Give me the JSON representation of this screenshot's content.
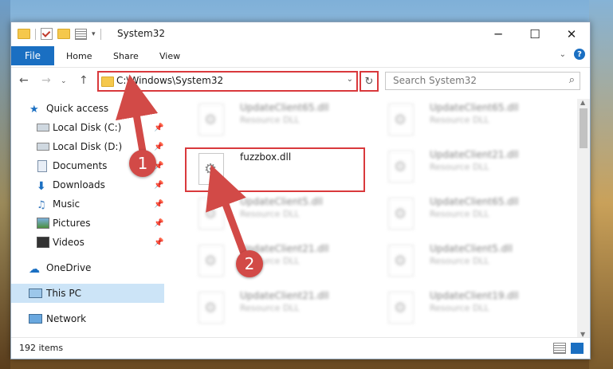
{
  "window": {
    "title": "System32"
  },
  "ribbon": {
    "tabs": [
      "File",
      "Home",
      "Share",
      "View"
    ]
  },
  "address": {
    "path": "C:\\Windows\\System32",
    "search_placeholder": "Search System32"
  },
  "sidebar": {
    "items": [
      {
        "label": "Quick access",
        "icon": "star-icon"
      },
      {
        "label": "Local Disk (C:)",
        "icon": "drive-icon"
      },
      {
        "label": "Local Disk (D:)",
        "icon": "drive-icon"
      },
      {
        "label": "Documents",
        "icon": "documents-icon"
      },
      {
        "label": "Downloads",
        "icon": "download-icon"
      },
      {
        "label": "Music",
        "icon": "music-icon"
      },
      {
        "label": "Pictures",
        "icon": "pictures-icon"
      },
      {
        "label": "Videos",
        "icon": "videos-icon"
      },
      {
        "label": "OneDrive",
        "icon": "cloud-icon"
      },
      {
        "label": "This PC",
        "icon": "computer-icon"
      },
      {
        "label": "Network",
        "icon": "network-icon"
      }
    ]
  },
  "files": [
    {
      "name": "UpdateClient65.dll",
      "type": "Resource DLL"
    },
    {
      "name": "UpdateClient65.dll",
      "type": "Resource DLL"
    },
    {
      "name": "fuzzbox.dll",
      "type": ""
    },
    {
      "name": "UpdateClient21.dll",
      "type": "Resource DLL"
    },
    {
      "name": "UpdateClient5.dll",
      "type": "Resource DLL"
    },
    {
      "name": "UpdateClient65.dll",
      "type": "Resource DLL"
    },
    {
      "name": "UpdateClient21.dll",
      "type": "Resource DLL"
    },
    {
      "name": "UpdateClient5.dll",
      "type": "Resource DLL"
    },
    {
      "name": "UpdateClient21.dll",
      "type": "Resource DLL"
    },
    {
      "name": "UpdateClient19.dll",
      "type": "Resource DLL"
    }
  ],
  "status": {
    "items_count": "192 items"
  },
  "callouts": [
    "1",
    "2"
  ],
  "colors": {
    "accent": "#1a6fc2",
    "highlight": "#d9393c",
    "callout": "#d24a47"
  }
}
